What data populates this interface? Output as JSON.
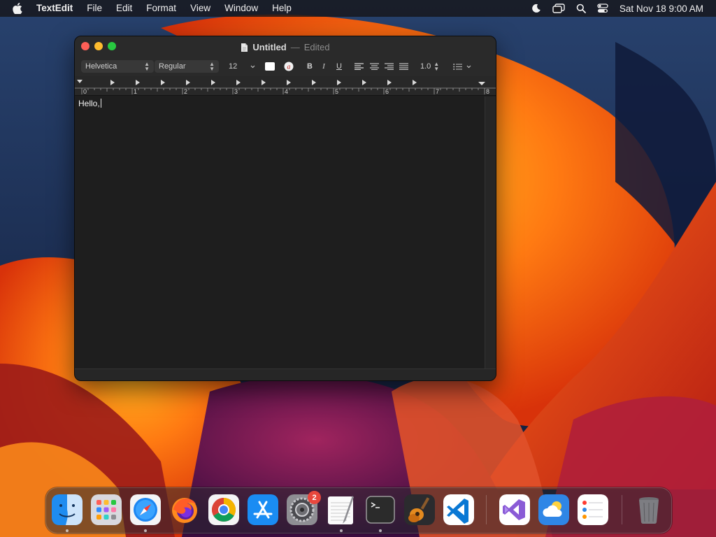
{
  "menubar": {
    "app_name": "TextEdit",
    "items": [
      "File",
      "Edit",
      "Format",
      "View",
      "Window",
      "Help"
    ],
    "clock": "Sat Nov 18  9:00 AM",
    "status_icons": [
      "moon-icon",
      "screen-mirroring-icon",
      "spotlight-search-icon",
      "control-center-icon"
    ]
  },
  "window": {
    "title": "Untitled",
    "separator": "—",
    "status": "Edited"
  },
  "toolbar": {
    "font_family": "Helvetica",
    "font_style": "Regular",
    "font_size": "12",
    "bold": "B",
    "italic": "I",
    "underline": "U",
    "line_spacing": "1.0"
  },
  "ruler": {
    "labels": [
      "0",
      "1",
      "2",
      "3",
      "4",
      "5",
      "6",
      "7",
      "8"
    ]
  },
  "document": {
    "text": "Hello,"
  },
  "dock": {
    "apps": [
      "Finder",
      "Launchpad",
      "Safari",
      "Firefox",
      "Chrome",
      "App Store",
      "System Settings",
      "TextEdit",
      "Terminal",
      "GarageBand",
      "Visual Studio Code",
      "Visual Studio",
      "Weather",
      "Reminders",
      "Trash"
    ],
    "settings_badge": "2"
  }
}
